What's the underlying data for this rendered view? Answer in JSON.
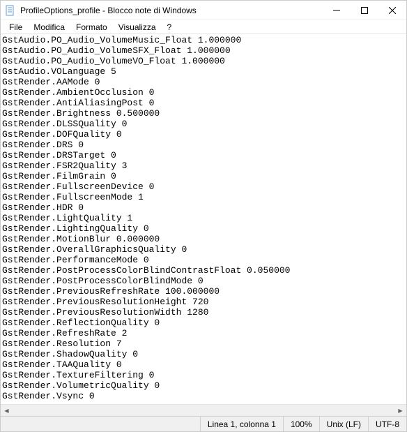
{
  "titlebar": {
    "title": "ProfileOptions_profile - Blocco note di Windows"
  },
  "menu": {
    "file": "File",
    "edit": "Modifica",
    "format": "Formato",
    "view": "Visualizza",
    "help": "?"
  },
  "lines": [
    "GstAudio.PO_Audio_VolumeMusic_Float 1.000000",
    "GstAudio.PO_Audio_VolumeSFX_Float 1.000000",
    "GstAudio.PO_Audio_VolumeVO_Float 1.000000",
    "GstAudio.VOLanguage 5",
    "GstRender.AAMode 0",
    "GstRender.AmbientOcclusion 0",
    "GstRender.AntiAliasingPost 0",
    "GstRender.Brightness 0.500000",
    "GstRender.DLSSQuality 0",
    "GstRender.DOFQuality 0",
    "GstRender.DRS 0",
    "GstRender.DRSTarget 0",
    "GstRender.FSR2Quality 3",
    "GstRender.FilmGrain 0",
    "GstRender.FullscreenDevice 0",
    "GstRender.FullscreenMode 1",
    "GstRender.HDR 0",
    "GstRender.LightQuality 1",
    "GstRender.LightingQuality 0",
    "GstRender.MotionBlur 0.000000",
    "GstRender.OverallGraphicsQuality 0",
    "GstRender.PerformanceMode 0",
    "GstRender.PostProcessColorBlindContrastFloat 0.050000",
    "GstRender.PostProcessColorBlindMode 0",
    "GstRender.PreviousRefreshRate 100.000000",
    "GstRender.PreviousResolutionHeight 720",
    "GstRender.PreviousResolutionWidth 1280",
    "GstRender.ReflectionQuality 0",
    "GstRender.RefreshRate 2",
    "GstRender.Resolution 7",
    "GstRender.ShadowQuality 0",
    "GstRender.TAAQuality 0",
    "GstRender.TextureFiltering 0",
    "GstRender.VolumetricQuality 0",
    "GstRender.Vsync 0"
  ],
  "status": {
    "position": "Linea 1, colonna 1",
    "zoom": "100%",
    "line_ending": "Unix (LF)",
    "encoding": "UTF-8"
  }
}
